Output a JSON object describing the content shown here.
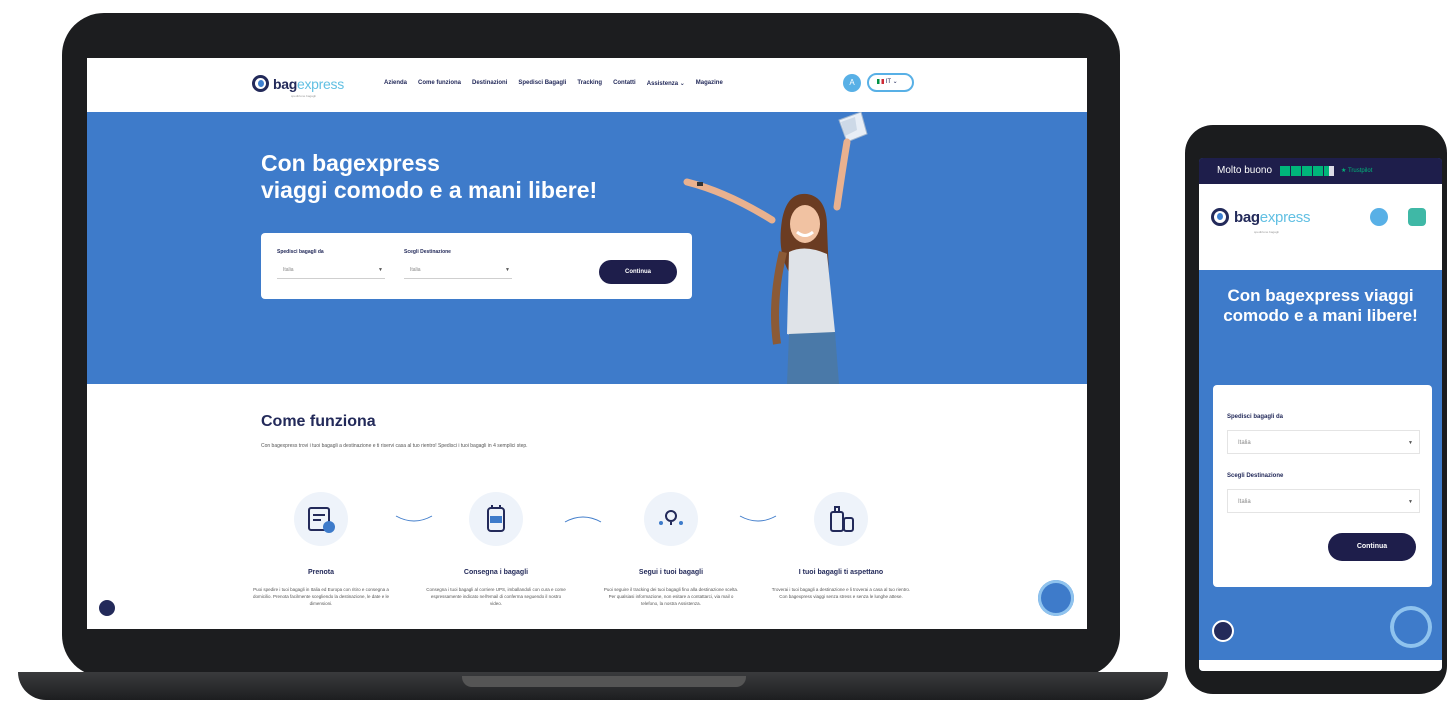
{
  "brand": {
    "name_main": "bag",
    "name_accent": "express",
    "tagline": "spedizione bagagli"
  },
  "nav": {
    "links": [
      "Azienda",
      "Come funziona",
      "Destinazioni",
      "Spedisci Bagagli",
      "Tracking",
      "Contatti",
      "Assistenza ⌄",
      "Magazine"
    ],
    "avatar_label": "A",
    "language": "IT ⌄"
  },
  "hero": {
    "title_line1": "Con bagexpress",
    "title_line2": "viaggi comodo e a mani libere!",
    "form": {
      "from_label": "Spedisci bagagli da",
      "from_value": "Italia",
      "to_label": "Scegli Destinazione",
      "to_value": "Italia",
      "submit_label": "Continua"
    }
  },
  "how_it_works": {
    "title": "Come funziona",
    "subtitle": "Con bagexpress trovi i tuoi bagagli a destinazione e ti riservi casa al tuo rientro! Spedisci i tuoi bagagli in 4 semplici step.",
    "steps": [
      {
        "title": "Prenota",
        "text": "Puoi spedire i tuoi bagagli in Italia ed Europa con ritiro e consegna a domicilio. Prenota facilmente scegliendo la destinazione, le date e le dimensioni."
      },
      {
        "title": "Consegna i bagagli",
        "text": "Consegna i tuoi bagagli al corriere UPS, imballandoli con cura e come espressamente indicato nell'email di conferma seguendo il nostro video."
      },
      {
        "title": "Segui i tuoi bagagli",
        "text": "Puoi seguire il tracking dei tuoi bagagli fino alla destinazione scelta. Per qualsiasi informazione, non esitare a contattarci, via mail o telefono, la nostra Assistenza."
      },
      {
        "title": "I tuoi bagagli ti aspettano",
        "text": "Troverai i tuoi bagagli a destinazione e li troverai a casa al tuo rientro. Con bagexpress viaggi senza stress e senza le lunghe attese."
      }
    ]
  },
  "mobile": {
    "trust_text": "Molto buono",
    "trustpilot_label": "★ Trustpilot",
    "rating_stars": 4.5,
    "hero_title": "Con bagexpress viaggi comodo e a mani libere!",
    "form": {
      "from_label": "Spedisci bagagli da",
      "from_value": "Italia",
      "to_label": "Scegli Destinazione",
      "to_value": "Italia",
      "submit_label": "Continua"
    }
  },
  "colors": {
    "primary_blue": "#3e7bca",
    "navy": "#1e1e4b",
    "accent_cyan": "#62c0e3",
    "trust_green": "#00b67a"
  }
}
